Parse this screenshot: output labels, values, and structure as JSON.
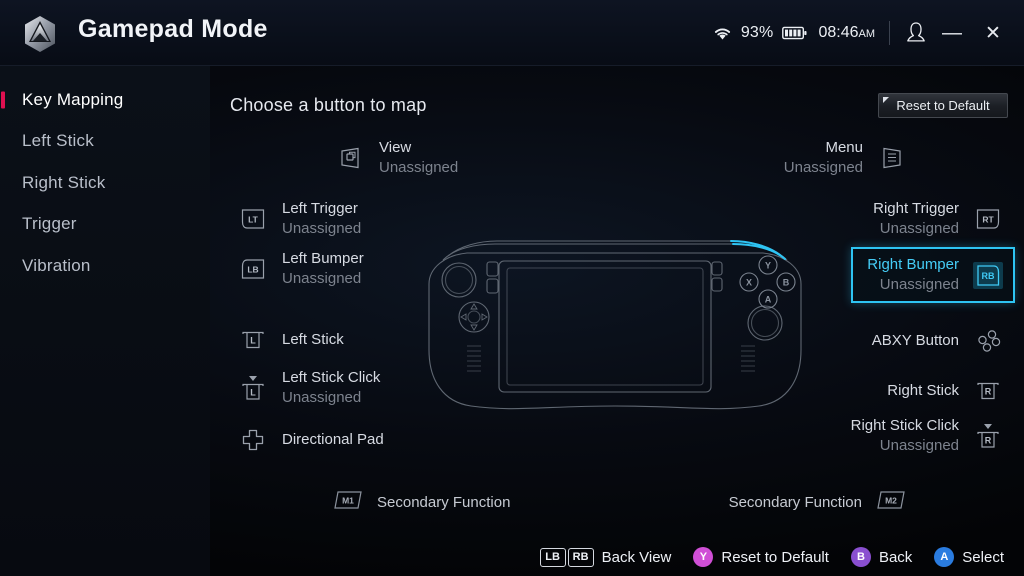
{
  "window": {
    "title": "Gamepad Mode",
    "logo_icon": "hexagon-logo-icon",
    "minimize_label": "—",
    "close_label": "✕"
  },
  "status": {
    "wifi_icon": "wifi-icon",
    "battery_percent": "93%",
    "battery_icon": "battery-icon",
    "time": "08:46",
    "ampm": "AM",
    "user_icon": "user-avatar-icon"
  },
  "sidebar": {
    "items": [
      {
        "label": "Key Mapping",
        "active": true
      },
      {
        "label": "Left Stick",
        "active": false
      },
      {
        "label": "Right Stick",
        "active": false
      },
      {
        "label": "Trigger",
        "active": false
      },
      {
        "label": "Vibration",
        "active": false
      }
    ],
    "active_indicator_color": "#e01050"
  },
  "main": {
    "heading": "Choose a button to map",
    "reset_button": "Reset to Default"
  },
  "mappings": {
    "left": [
      {
        "name": "View",
        "value": "Unassigned",
        "icon": "view-button-icon"
      },
      {
        "name": "Left Trigger",
        "value": "Unassigned",
        "icon": "lt-badge-icon"
      },
      {
        "name": "Left Bumper",
        "value": "Unassigned",
        "icon": "lb-badge-icon"
      },
      {
        "name": "Left Stick",
        "value": "",
        "icon": "left-stick-icon"
      },
      {
        "name": "Left Stick Click",
        "value": "Unassigned",
        "icon": "left-stick-click-icon"
      },
      {
        "name": "Directional Pad",
        "value": "",
        "icon": "dpad-icon"
      }
    ],
    "right": [
      {
        "name": "Menu",
        "value": "Unassigned",
        "icon": "menu-button-icon",
        "selected": false
      },
      {
        "name": "Right Trigger",
        "value": "Unassigned",
        "icon": "rt-badge-icon",
        "selected": false
      },
      {
        "name": "Right Bumper",
        "value": "Unassigned",
        "icon": "rb-badge-icon",
        "selected": true
      },
      {
        "name": "ABXY Button",
        "value": "",
        "icon": "abxy-icon",
        "selected": false
      },
      {
        "name": "Right Stick",
        "value": "",
        "icon": "right-stick-icon",
        "selected": false
      },
      {
        "name": "Right Stick Click",
        "value": "Unassigned",
        "icon": "right-stick-click-icon",
        "selected": false
      }
    ],
    "secondary": [
      {
        "key": "M1",
        "label": "Secondary Function"
      },
      {
        "key": "M2",
        "label": "Secondary Function"
      }
    ],
    "selection_color": "#2ec4f3"
  },
  "device": {
    "name": "handheld-gamepad-illustration",
    "face_buttons": [
      "Y",
      "X",
      "B",
      "A"
    ],
    "highlight": "right-bumper"
  },
  "hints": [
    {
      "keys": [
        "LB",
        "RB"
      ],
      "label": "Back View",
      "style": "box"
    },
    {
      "keys": [
        "Y"
      ],
      "label": "Reset to Default",
      "style": "circle",
      "color": "#d04fd6"
    },
    {
      "keys": [
        "B"
      ],
      "label": "Back",
      "style": "circle",
      "color": "#8a4fd0"
    },
    {
      "keys": [
        "A"
      ],
      "label": "Select",
      "style": "circle",
      "color": "#2a7ce0"
    }
  ]
}
